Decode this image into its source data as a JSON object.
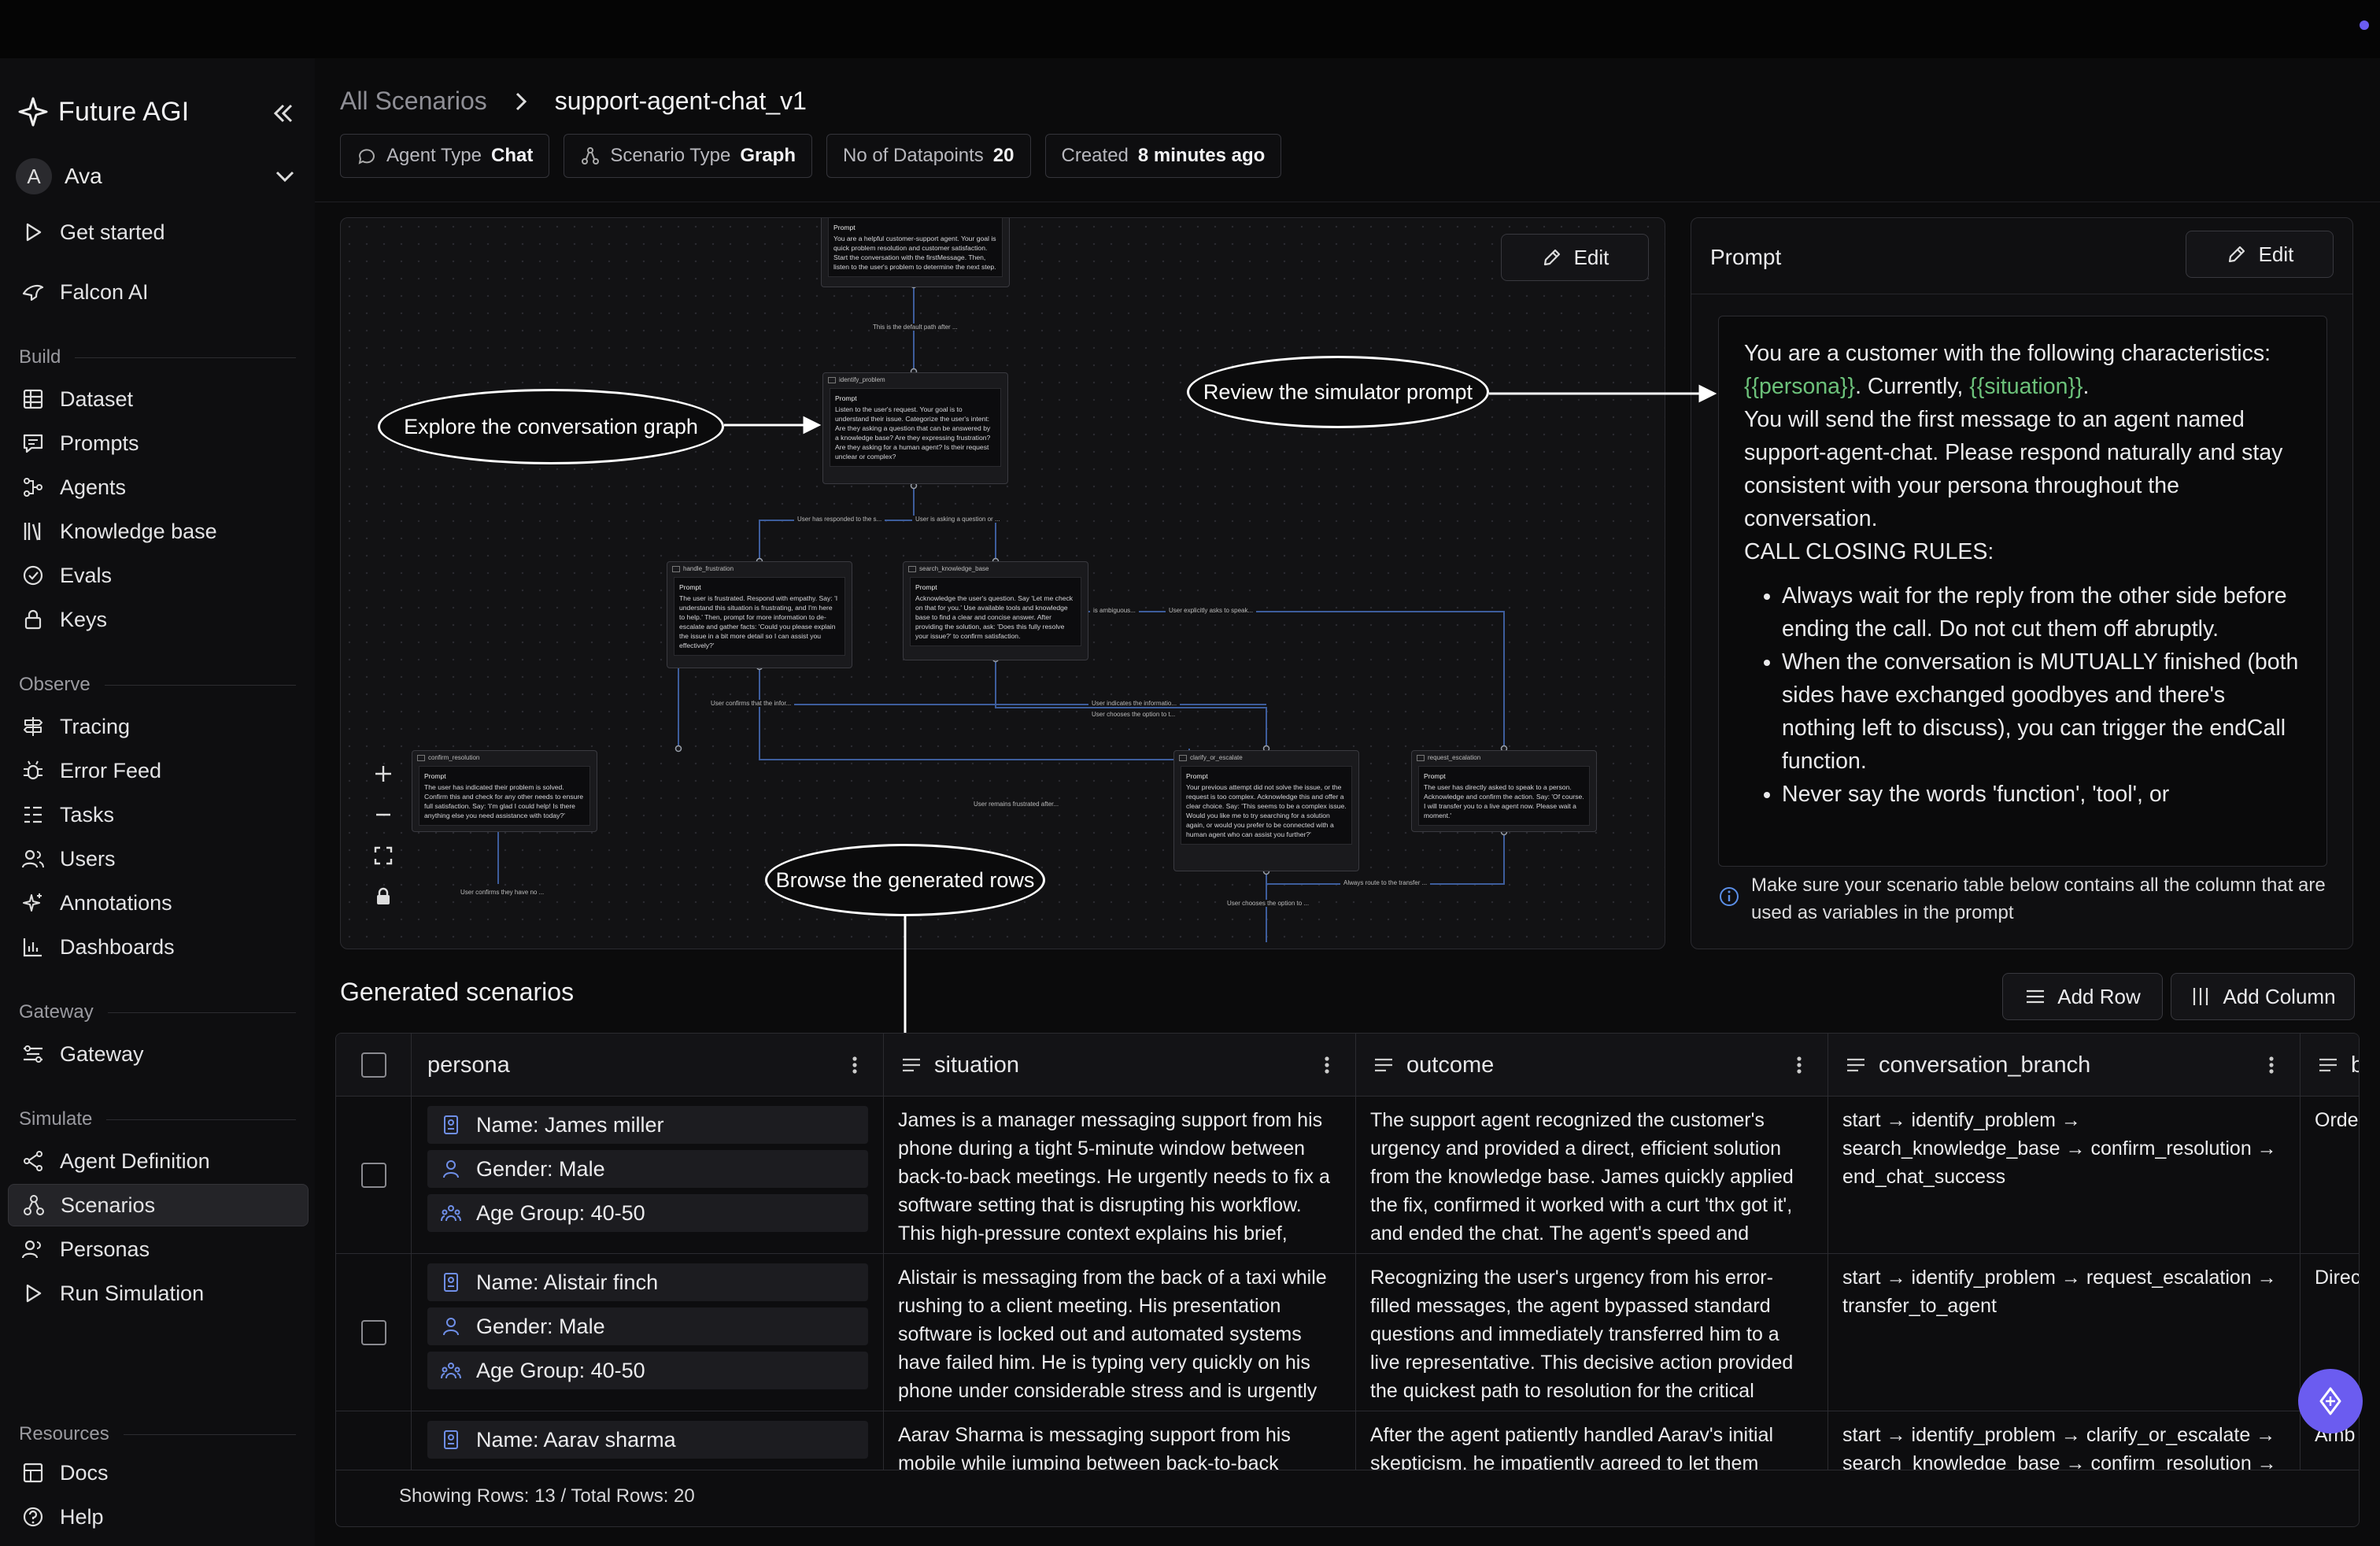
{
  "app": {
    "brand": "Future AGI",
    "user_initial": "A",
    "user_name": "Ava"
  },
  "sidebar": {
    "top_items": [
      {
        "label": "Get started",
        "icon": "play-icon"
      },
      {
        "label": "Falcon AI",
        "icon": "falcon-icon"
      }
    ],
    "sections": [
      {
        "title": "Build",
        "items": [
          "Dataset",
          "Prompts",
          "Agents",
          "Knowledge base",
          "Evals",
          "Keys"
        ]
      },
      {
        "title": "Observe",
        "items": [
          "Tracing",
          "Error Feed",
          "Tasks",
          "Users",
          "Annotations",
          "Dashboards"
        ]
      },
      {
        "title": "Gateway",
        "items": [
          "Gateway"
        ]
      },
      {
        "title": "Simulate",
        "items": [
          "Agent Definition",
          "Scenarios",
          "Personas",
          "Run Simulation"
        ]
      },
      {
        "title": "Resources",
        "items": [
          "Docs",
          "Help"
        ]
      }
    ],
    "active_item": "Scenarios"
  },
  "header": {
    "breadcrumb_root": "All Scenarios",
    "breadcrumb_current": "support-agent-chat_v1",
    "tags": [
      {
        "key": "Agent Type",
        "value": "Chat"
      },
      {
        "key": "Scenario Type",
        "value": "Graph"
      },
      {
        "key": "No of Datapoints",
        "value": "20"
      },
      {
        "key": "Created",
        "value": "8 minutes ago"
      }
    ]
  },
  "graph": {
    "edit_label": "Edit",
    "nodes": [
      {
        "title": "",
        "prompt_label": "Prompt",
        "text": "You are a helpful customer-support agent. Your goal is quick problem resolution and customer satisfaction. Start the conversation with the firstMessage. Then, listen to the user's problem to determine the next step."
      },
      {
        "title": "identify_problem",
        "prompt_label": "Prompt",
        "text": "Listen to the user's request. Your goal is to understand their issue. Categorize the user's intent: Are they asking a question that can be answered by a knowledge base? Are they expressing frustration? Are they asking for a human agent? Is their request unclear or complex?"
      },
      {
        "title": "handle_frustration",
        "prompt_label": "Prompt",
        "text": "The user is frustrated. Respond with empathy. Say: 'I understand this situation is frustrating, and I'm here to help.' Then, prompt for more information to de-escalate and gather facts: 'Could you please explain the issue in a bit more detail so I can assist you effectively?'"
      },
      {
        "title": "search_knowledge_base",
        "prompt_label": "Prompt",
        "text": "Acknowledge the user's question. Say 'Let me check on that for you.' Use available tools and knowledge base to find a clear and concise answer. After providing the solution, ask: 'Does this fully resolve your issue?' to confirm satisfaction."
      },
      {
        "title": "confirm_resolution",
        "prompt_label": "Prompt",
        "text": "The user has indicated their problem is solved. Confirm this and check for any other needs to ensure full satisfaction. Say: 'I'm glad I could help! Is there anything else you need assistance with today?'"
      },
      {
        "title": "clarify_or_escalate",
        "prompt_label": "Prompt",
        "text": "Your previous attempt did not solve the issue, or the request is too complex. Acknowledge this and offer a clear choice. Say: 'This seems to be a complex issue. Would you like me to try searching for a solution again, or would you prefer to be connected with a human agent who can assist you further?'"
      },
      {
        "title": "request_escalation",
        "prompt_label": "Prompt",
        "text": "The user has directly asked to speak to a person. Acknowledge and confirm the action. Say: 'Of course. I will transfer you to a live agent now. Please wait a moment.'"
      }
    ],
    "edges": [
      "This is the default path after ...",
      "User has responded to the s...",
      "User is asking a question or ...",
      "is ambiguous...",
      "User explicitly asks to speak...",
      "User confirms that the infor...",
      "User indicates the informatio...",
      "User chooses the option to t...",
      "User remains frustrated after...",
      "User confirms they have no ...",
      "Always route to the transfer ...",
      "User chooses the option to ..."
    ]
  },
  "annotations": {
    "explore": "Explore the conversation graph",
    "review": "Review the simulator prompt",
    "browse": "Browse the generated rows"
  },
  "prompt_panel": {
    "title": "Prompt",
    "edit_label": "Edit",
    "line1": "You are a customer with the following characteristics:",
    "var_persona": "{{persona}}",
    "text_currently": ". Currently, ",
    "var_situation": "{{situation}}",
    "text_period": ".",
    "para2": "You will send the first message to an agent named support-agent-chat. Please respond naturally and stay consistent with your persona throughout the conversation.",
    "rules_title": "CALL CLOSING RULES:",
    "rules": [
      "Always wait for the reply from the other side before ending the call. Do not cut them off abruptly.",
      "When the conversation is MUTUALLY finished (both sides have exchanged goodbyes and there's nothing left to discuss), you can trigger the endCall function.",
      "Never say the words 'function', 'tool', or"
    ],
    "note": "Make sure your scenario table below contains all the column that are used as variables in the prompt"
  },
  "table": {
    "title": "Generated scenarios",
    "add_row": "Add Row",
    "add_column": "Add Column",
    "columns": [
      "persona",
      "situation",
      "outcome",
      "conversation_branch",
      "b"
    ],
    "rows": [
      {
        "persona": [
          "Name: James miller",
          "Gender: Male",
          "Age Group: 40-50"
        ],
        "situation": "James is a manager messaging support from his phone during a tight 5-minute window between back-to-back meetings. He urgently needs to fix a software setting that is disrupting his workflow. This high-pressure context explains his brief,",
        "outcome": "The support agent recognized the customer's urgency and provided a direct, efficient solution from the knowledge base. James quickly applied the fix, confirmed it worked with a curt 'thx got it', and ended the chat. The agent's speed and",
        "branch": "start → identify_problem → search_knowledge_base → confirm_resolution → end_chat_success",
        "extra": "Orde"
      },
      {
        "persona": [
          "Name: Alistair finch",
          "Gender: Male",
          "Age Group: 40-50"
        ],
        "situation": "Alistair is messaging from the back of a taxi while rushing to a client meeting. His presentation software is locked out and automated systems have failed him. He is typing very quickly on his phone under considerable stress and is urgently",
        "outcome": "Recognizing the user's urgency from his error-filled messages, the agent bypassed standard questions and immediately transferred him to a live representative. This decisive action provided the quickest path to resolution for the critical",
        "branch": "start → identify_problem → request_escalation → transfer_to_agent",
        "extra": "Direc"
      },
      {
        "persona": [
          "Name: Aarav sharma"
        ],
        "situation": "Aarav Sharma is messaging support from his mobile while jumping between back-to-back",
        "outcome": "After the agent patiently handled Aarav's initial skepticism, he impatiently agreed to let them",
        "branch": "start → identify_problem → clarify_or_escalate → search_knowledge_base → confirm_resolution →",
        "extra": "Amb"
      }
    ],
    "footer": "Showing Rows: 13 / Total Rows: 20"
  }
}
